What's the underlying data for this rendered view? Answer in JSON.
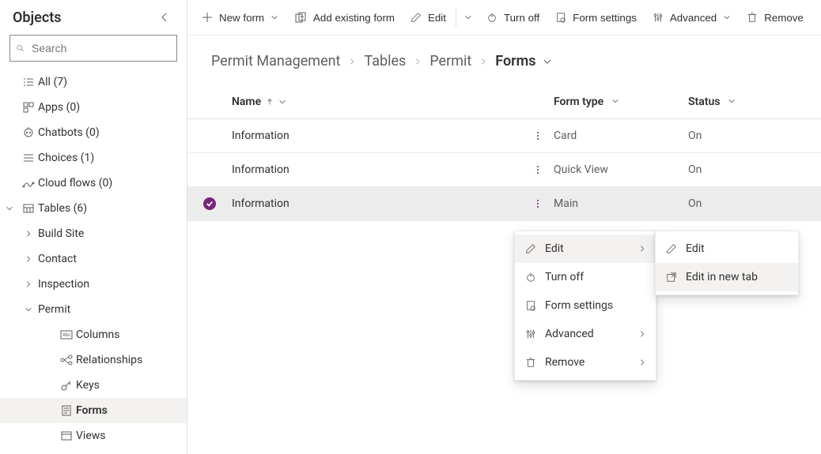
{
  "sidebar": {
    "title": "Objects",
    "search_placeholder": "Search",
    "items": [
      {
        "label": "All",
        "count": "(7)"
      },
      {
        "label": "Apps",
        "count": "(0)"
      },
      {
        "label": "Chatbots",
        "count": "(0)"
      },
      {
        "label": "Choices",
        "count": "(1)"
      },
      {
        "label": "Cloud flows",
        "count": "(0)"
      },
      {
        "label": "Tables",
        "count": "(6)"
      }
    ],
    "tables_children": [
      {
        "label": "Build Site"
      },
      {
        "label": "Contact"
      },
      {
        "label": "Inspection"
      },
      {
        "label": "Permit"
      }
    ],
    "permit_children": [
      {
        "label": "Columns"
      },
      {
        "label": "Relationships"
      },
      {
        "label": "Keys"
      },
      {
        "label": "Forms"
      },
      {
        "label": "Views"
      }
    ]
  },
  "cmdbar": {
    "new_form": "New form",
    "add_existing": "Add existing form",
    "edit": "Edit",
    "turn_off": "Turn off",
    "form_settings": "Form settings",
    "advanced": "Advanced",
    "remove": "Remove"
  },
  "breadcrumb": {
    "app": "Permit Management",
    "lvl1": "Tables",
    "lvl2": "Permit",
    "current": "Forms"
  },
  "table": {
    "cols": {
      "name": "Name",
      "type": "Form type",
      "status": "Status"
    },
    "rows": [
      {
        "name": "Information",
        "type": "Card",
        "status": "On"
      },
      {
        "name": "Information",
        "type": "Quick View",
        "status": "On"
      },
      {
        "name": "Information",
        "type": "Main",
        "status": "On"
      }
    ]
  },
  "ctx": {
    "edit": "Edit",
    "turn_off": "Turn off",
    "form_settings": "Form settings",
    "advanced": "Advanced",
    "remove": "Remove",
    "sub_edit": "Edit",
    "sub_edit_new_tab": "Edit in new tab"
  }
}
